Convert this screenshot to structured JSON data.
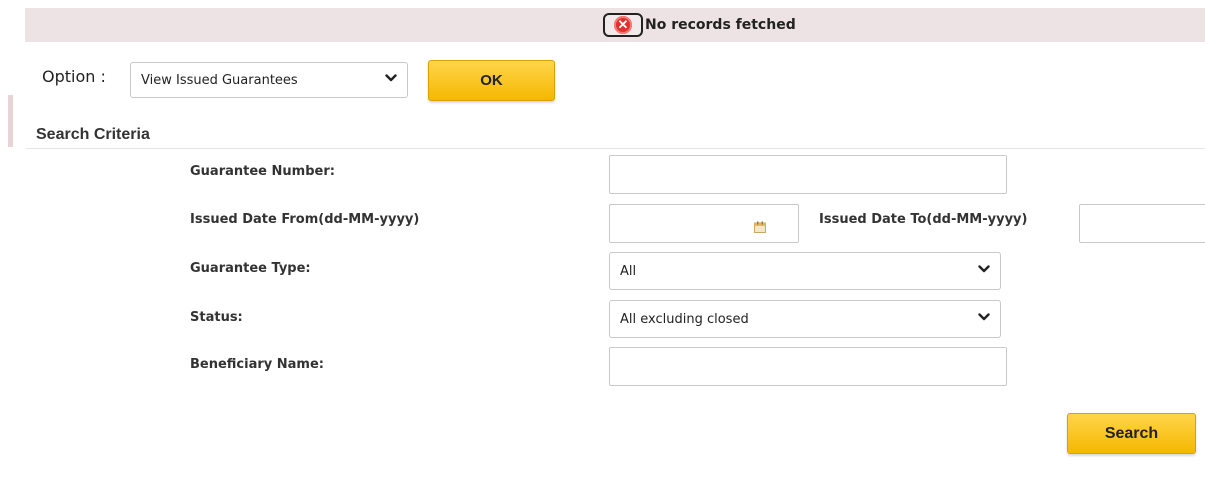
{
  "message": {
    "icon": "error-icon",
    "icon_glyph": "✕",
    "text": "No records fetched"
  },
  "option": {
    "label": "Option :",
    "selected": "View Issued Guarantees",
    "ok_label": "OK"
  },
  "search_criteria": {
    "title": "Search Criteria",
    "fields": {
      "guarantee_number": {
        "label": "Guarantee Number:",
        "value": ""
      },
      "issued_date_from": {
        "label": "Issued Date From(dd-MM-yyyy)",
        "value": ""
      },
      "issued_date_to": {
        "label": "Issued Date To(dd-MM-yyyy)",
        "value": ""
      },
      "guarantee_type": {
        "label": "Guarantee Type:",
        "selected": "All"
      },
      "status": {
        "label": "Status:",
        "selected": "All excluding closed"
      },
      "beneficiary_name": {
        "label": "Beneficiary Name:",
        "value": ""
      }
    },
    "search_label": "Search"
  },
  "colors": {
    "accent": "#f5b800",
    "message_bar": "#ede3e4",
    "error": "#e2302d"
  }
}
